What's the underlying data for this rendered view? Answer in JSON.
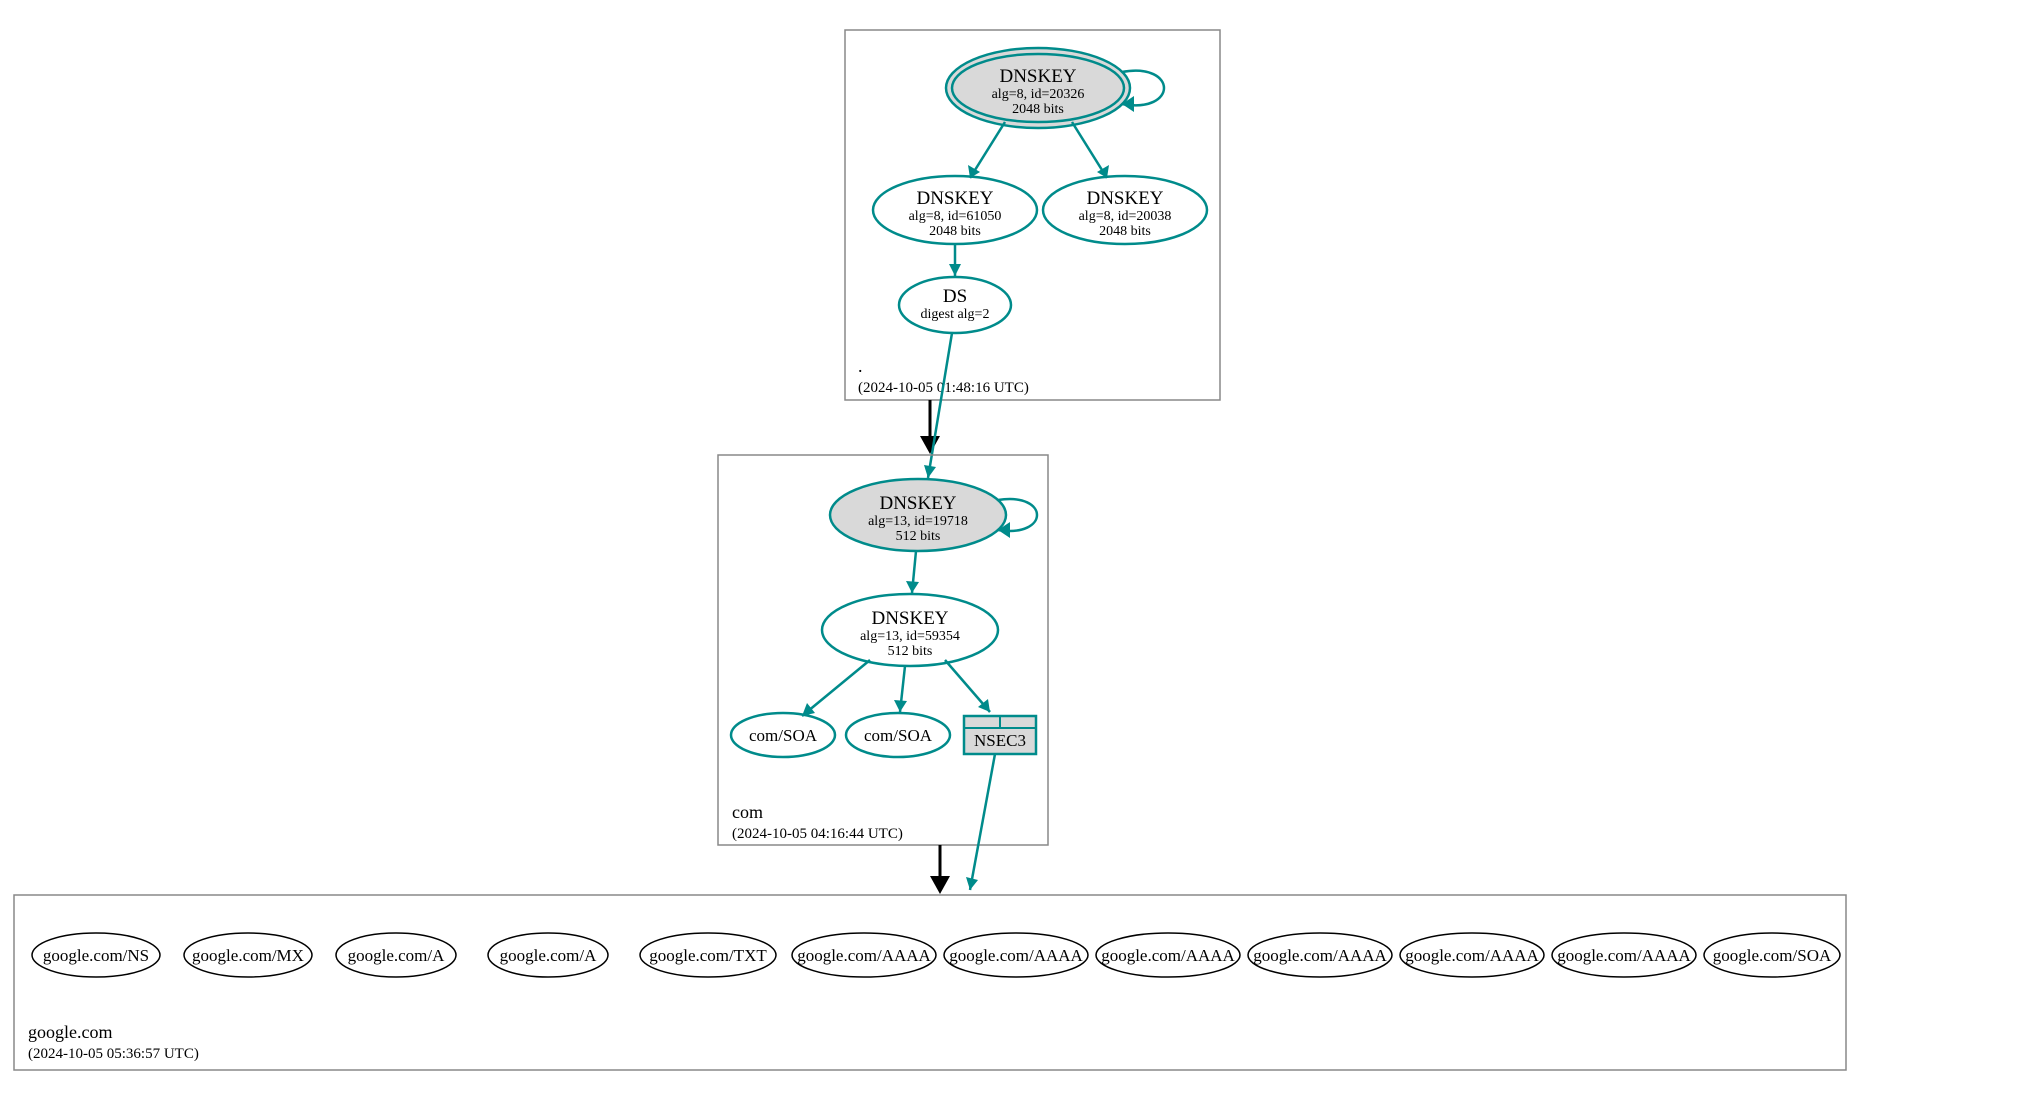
{
  "colors": {
    "teal": "#008b8b",
    "grey": "#d9d9d9"
  },
  "zones": {
    "root": {
      "name": ".",
      "timestamp": "(2024-10-05 01:48:16 UTC)",
      "nodes": {
        "k20326": {
          "title": "DNSKEY",
          "line2": "alg=8, id=20326",
          "line3": "2048 bits"
        },
        "k61050": {
          "title": "DNSKEY",
          "line2": "alg=8, id=61050",
          "line3": "2048 bits"
        },
        "k20038": {
          "title": "DNSKEY",
          "line2": "alg=8, id=20038",
          "line3": "2048 bits"
        },
        "ds": {
          "title": "DS",
          "line2": "digest alg=2"
        }
      }
    },
    "com": {
      "name": "com",
      "timestamp": "(2024-10-05 04:16:44 UTC)",
      "nodes": {
        "k19718": {
          "title": "DNSKEY",
          "line2": "alg=13, id=19718",
          "line3": "512 bits"
        },
        "k59354": {
          "title": "DNSKEY",
          "line2": "alg=13, id=59354",
          "line3": "512 bits"
        },
        "soa1": {
          "title": "com/SOA"
        },
        "soa2": {
          "title": "com/SOA"
        },
        "nsec3": {
          "title": "NSEC3"
        }
      }
    },
    "google": {
      "name": "google.com",
      "timestamp": "(2024-10-05 05:36:57 UTC)",
      "records": [
        "google.com/NS",
        "google.com/MX",
        "google.com/A",
        "google.com/A",
        "google.com/TXT",
        "google.com/AAAA",
        "google.com/AAAA",
        "google.com/AAAA",
        "google.com/AAAA",
        "google.com/AAAA",
        "google.com/AAAA",
        "google.com/SOA"
      ]
    }
  }
}
